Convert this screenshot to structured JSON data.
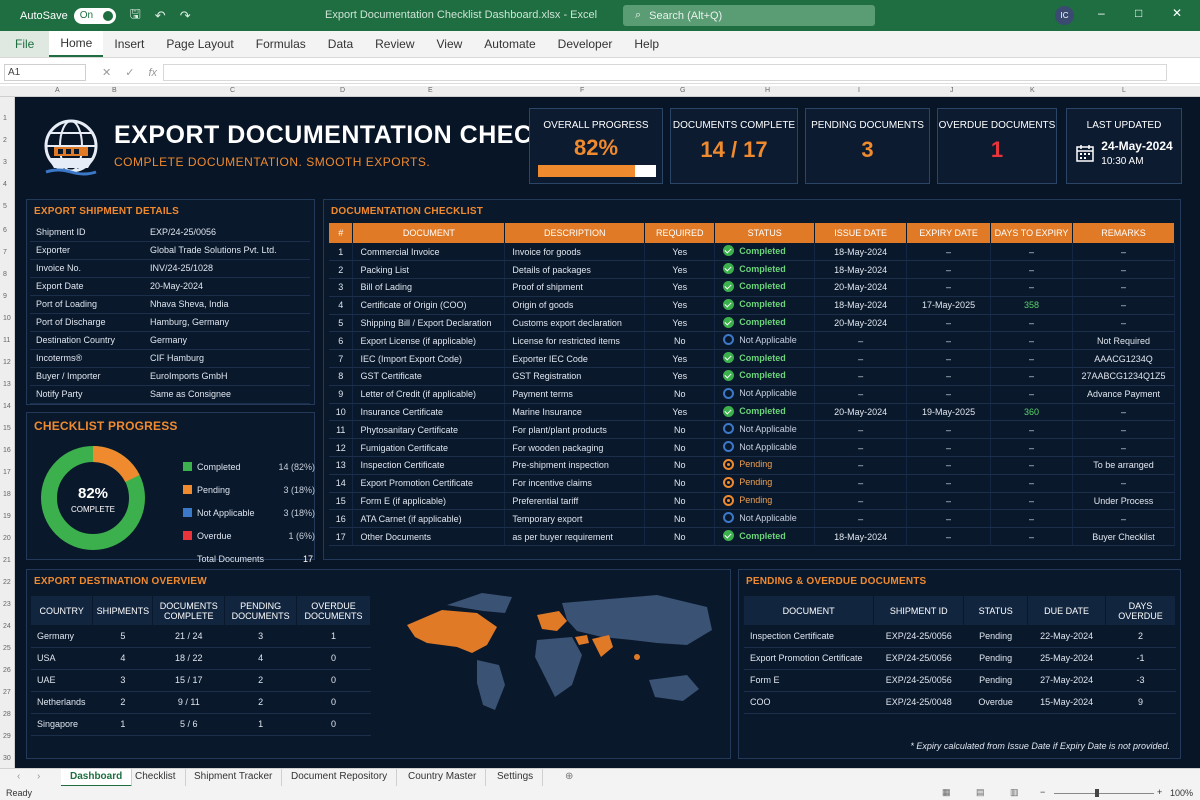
{
  "titlebar": {
    "autosave": "AutoSave",
    "toggle": "On",
    "doc_title": "Export Documentation Checklist Dashboard.xlsx - Excel",
    "search_placeholder": "Search (Alt+Q)",
    "avatar": "IC"
  },
  "ribbon": {
    "tabs": [
      "File",
      "Home",
      "Insert",
      "Page Layout",
      "Formulas",
      "Data",
      "Review",
      "View",
      "Automate",
      "Developer",
      "Help"
    ]
  },
  "formula_bar": {
    "name_box": "A1",
    "fx": "fx"
  },
  "header": {
    "title": "EXPORT DOCUMENTATION CHECKLIST",
    "subtitle": "COMPLETE DOCUMENTATION. SMOOTH EXPORTS."
  },
  "kpis": {
    "overall": {
      "label": "OVERALL PROGRESS",
      "value": "82%",
      "progress": 0.82
    },
    "complete": {
      "label": "DOCUMENTS COMPLETE",
      "value": "14 / 17"
    },
    "pending": {
      "label": "PENDING DOCUMENTS",
      "value": "3"
    },
    "overdue": {
      "label": "OVERDUE DOCUMENTS",
      "value": "1"
    },
    "updated": {
      "label": "LAST UPDATED",
      "date": "24-May-2024",
      "time": "10:30 AM"
    }
  },
  "shipment": {
    "title": "EXPORT SHIPMENT DETAILS",
    "rows": [
      [
        "Shipment ID",
        "EXP/24-25/0056"
      ],
      [
        "Exporter",
        "Global Trade Solutions Pvt. Ltd."
      ],
      [
        "Invoice No.",
        "INV/24-25/1028"
      ],
      [
        "Export Date",
        "20-May-2024"
      ],
      [
        "Port of Loading",
        "Nhava Sheva, India"
      ],
      [
        "Port of Discharge",
        "Hamburg, Germany"
      ],
      [
        "Destination Country",
        "Germany"
      ],
      [
        "Incoterms®",
        "CIF Hamburg"
      ],
      [
        "Buyer / Importer",
        "EuroImports GmbH"
      ],
      [
        "Notify Party",
        "Same as Consignee"
      ]
    ]
  },
  "progress": {
    "title": "CHECKLIST PROGRESS",
    "center_value": "82%",
    "center_label": "COMPLETE",
    "items": [
      {
        "label": "Completed",
        "value": "14 (82%)",
        "count": 14,
        "color": "#3cb04c"
      },
      {
        "label": "Pending",
        "value": "3 (18%)",
        "count": 3,
        "color": "#f08a2e"
      },
      {
        "label": "Not Applicable",
        "value": "3 (18%)",
        "count": 3,
        "color": "#3c78c8"
      },
      {
        "label": "Overdue",
        "value": "1 (6%)",
        "count": 1,
        "color": "#e8343a"
      }
    ],
    "total_label": "Total Documents",
    "total_value": "17"
  },
  "checklist": {
    "title": "DOCUMENTATION CHECKLIST",
    "headers": [
      "#",
      "DOCUMENT",
      "DESCRIPTION",
      "REQUIRED",
      "STATUS",
      "ISSUE DATE",
      "EXPIRY DATE",
      "DAYS TO EXPIRY",
      "REMARKS"
    ],
    "rows": [
      [
        "1",
        "Commercial Invoice",
        "Invoice for goods",
        "Yes",
        "Completed",
        "18-May-2024",
        "–",
        "–",
        "–"
      ],
      [
        "2",
        "Packing List",
        "Details of packages",
        "Yes",
        "Completed",
        "18-May-2024",
        "–",
        "–",
        "–"
      ],
      [
        "3",
        "Bill of Lading",
        "Proof of shipment",
        "Yes",
        "Completed",
        "20-May-2024",
        "–",
        "–",
        "–"
      ],
      [
        "4",
        "Certificate of Origin (COO)",
        "Origin of goods",
        "Yes",
        "Completed",
        "18-May-2024",
        "17-May-2025",
        "358",
        "–"
      ],
      [
        "5",
        "Shipping Bill / Export Declaration",
        "Customs export declaration",
        "Yes",
        "Completed",
        "20-May-2024",
        "–",
        "–",
        "–"
      ],
      [
        "6",
        "Export License (if applicable)",
        "License for restricted items",
        "No",
        "Not Applicable",
        "–",
        "–",
        "–",
        "Not Required"
      ],
      [
        "7",
        "IEC (Import Export Code)",
        "Exporter IEC Code",
        "Yes",
        "Completed",
        "–",
        "–",
        "–",
        "AAACG1234Q"
      ],
      [
        "8",
        "GST Certificate",
        "GST Registration",
        "Yes",
        "Completed",
        "–",
        "–",
        "–",
        "27AABCG1234Q1Z5"
      ],
      [
        "9",
        "Letter of Credit (if applicable)",
        "Payment terms",
        "No",
        "Not Applicable",
        "–",
        "–",
        "–",
        "Advance Payment"
      ],
      [
        "10",
        "Insurance Certificate",
        "Marine Insurance",
        "Yes",
        "Completed",
        "20-May-2024",
        "19-May-2025",
        "360",
        "–"
      ],
      [
        "11",
        "Phytosanitary Certificate",
        "For plant/plant products",
        "No",
        "Not Applicable",
        "–",
        "–",
        "–",
        "–"
      ],
      [
        "12",
        "Fumigation Certificate",
        "For wooden packaging",
        "No",
        "Not Applicable",
        "–",
        "–",
        "–",
        "–"
      ],
      [
        "13",
        "Inspection Certificate",
        "Pre-shipment inspection",
        "No",
        "Pending",
        "–",
        "–",
        "–",
        "To be arranged"
      ],
      [
        "14",
        "Export Promotion Certificate",
        "For incentive claims",
        "No",
        "Pending",
        "–",
        "–",
        "–",
        "–"
      ],
      [
        "15",
        "Form E (if applicable)",
        "Preferential tariff",
        "No",
        "Pending",
        "–",
        "–",
        "–",
        "Under Process"
      ],
      [
        "16",
        "ATA Carnet (if applicable)",
        "Temporary export",
        "No",
        "Not Applicable",
        "–",
        "–",
        "–",
        "–"
      ],
      [
        "17",
        "Other Documents",
        "as per buyer requirement",
        "No",
        "Completed",
        "18-May-2024",
        "–",
        "–",
        "Buyer Checklist"
      ]
    ]
  },
  "destinations": {
    "title": "EXPORT DESTINATION OVERVIEW",
    "headers": [
      "COUNTRY",
      "SHIPMENTS",
      "DOCUMENTS COMPLETE",
      "PENDING DOCUMENTS",
      "OVERDUE DOCUMENTS"
    ],
    "rows": [
      [
        "Germany",
        "5",
        "21 / 24",
        "3",
        "1"
      ],
      [
        "USA",
        "4",
        "18 / 22",
        "4",
        "0"
      ],
      [
        "UAE",
        "3",
        "15 / 17",
        "2",
        "0"
      ],
      [
        "Netherlands",
        "2",
        "9 / 11",
        "2",
        "0"
      ],
      [
        "Singapore",
        "1",
        "5 / 6",
        "1",
        "0"
      ]
    ]
  },
  "pending_overdue": {
    "title": "PENDING & OVERDUE DOCUMENTS",
    "headers": [
      "DOCUMENT",
      "SHIPMENT ID",
      "STATUS",
      "DUE DATE",
      "DAYS OVERDUE"
    ],
    "rows": [
      [
        "Inspection Certificate",
        "EXP/24-25/0056",
        "Pending",
        "22-May-2024",
        "2"
      ],
      [
        "Export Promotion Certificate",
        "EXP/24-25/0056",
        "Pending",
        "25-May-2024",
        "-1"
      ],
      [
        "Form E",
        "EXP/24-25/0056",
        "Pending",
        "27-May-2024",
        "-3"
      ],
      [
        "COO",
        "EXP/24-25/0048",
        "Overdue",
        "15-May-2024",
        "9"
      ]
    ],
    "note": "* Expiry calculated from Issue Date if Expiry Date is not provided."
  },
  "sheet_tabs": [
    "Dashboard",
    "Checklist",
    "Shipment Tracker",
    "Document Repository",
    "Country Master",
    "Settings"
  ],
  "statusbar": {
    "ready": "Ready",
    "zoom": "100%"
  },
  "colors": {
    "accent": "#f08a2e",
    "excel_green": "#1e6e41",
    "bg": "#081526",
    "completed": "#3cb04c",
    "not_applicable": "#3c78c8",
    "overdue": "#e8343a"
  }
}
